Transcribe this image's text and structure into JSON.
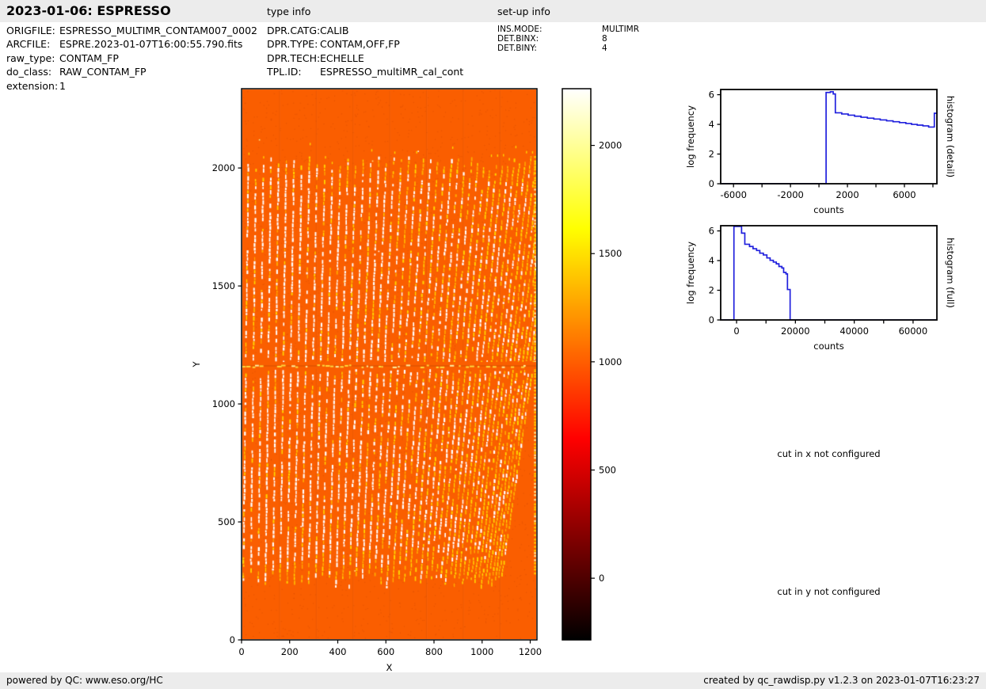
{
  "header": {
    "title": "2023-01-06: ESPRESSO",
    "type_info_label": "type info",
    "setup_info_label": "set-up info"
  },
  "file_info": {
    "rows": [
      {
        "label": "ORIGFILE:",
        "value": "ESPRESSO_MULTIMR_CONTAM007_0002"
      },
      {
        "label": "ARCFILE:",
        "value": "ESPRE.2023-01-07T16:00:55.790.fits"
      },
      {
        "label": "raw_type:",
        "value": "CONTAM_FP"
      },
      {
        "label": "do_class:",
        "value": "RAW_CONTAM_FP"
      },
      {
        "label": "extension:",
        "value": "1"
      }
    ]
  },
  "type_info": {
    "rows": [
      {
        "label": "DPR.CATG:",
        "value": "CALIB"
      },
      {
        "label": "DPR.TYPE:",
        "value": "CONTAM,OFF,FP"
      },
      {
        "label": "DPR.TECH:",
        "value": "ECHELLE"
      },
      {
        "label": "TPL.ID:",
        "value": "ESPRESSO_multiMR_cal_cont"
      }
    ]
  },
  "setup_info": {
    "rows": [
      {
        "label": "INS.MODE:",
        "value": "MULTIMR"
      },
      {
        "label": "DET.BINX:",
        "value": "8"
      },
      {
        "label": "DET.BINY:",
        "value": "4"
      }
    ]
  },
  "messages": {
    "cut_x": "cut in x not configured",
    "cut_y": "cut in y not configured"
  },
  "footer": {
    "left": "powered by QC: www.eso.org/HC",
    "right": "created by qc_rawdisp.py v1.2.3 on 2023-01-07T16:23:27"
  },
  "chart_data": [
    {
      "id": "raw_image",
      "type": "heatmap",
      "title": "",
      "xlabel": "X",
      "ylabel": "Y",
      "xlim": [
        0,
        1228
      ],
      "ylim": [
        0,
        2336
      ],
      "xticks": [
        0,
        200,
        400,
        600,
        800,
        1000,
        1200
      ],
      "yticks": [
        0,
        500,
        1000,
        1500,
        2000
      ],
      "colormap": "hot",
      "background_level_counts": 1000,
      "background_color_hex": "#fa5e00",
      "stripe_color_hexes": [
        "#ffffff",
        "#ffd400",
        "#ffaa00"
      ],
      "stripe_region_y": [
        250,
        2050
      ],
      "stripe_count": 46,
      "bright_row_y": 1165,
      "description": "Raw CONTAM_FP echelle frame: orange background with ~46 near-vertical bright dashed order stripes (whiter at left, denser/yellower and leaning left toward the right edge), a horizontal feature row near Y=1165, faint amplifier seams, plain orange above Y~2050 and below Y~250"
    },
    {
      "id": "colorbar",
      "type": "colorbar",
      "colormap": "hot",
      "ticks": [
        0,
        500,
        1000,
        1500,
        2000
      ],
      "range": [
        -285,
        2262
      ]
    },
    {
      "id": "hist_detail",
      "type": "line",
      "right_label": "histogram (detail)",
      "xlabel": "counts",
      "ylabel": "log frequency",
      "xlim": [
        -6900,
        8280
      ],
      "ylim": [
        0,
        6.35
      ],
      "xticks_all": [
        -6000,
        -4000,
        -2000,
        0,
        2000,
        4000,
        6000,
        8000
      ],
      "xticks_labeled": [
        -6000,
        -2000,
        2000,
        6000
      ],
      "yticks": [
        0,
        2,
        4,
        6
      ],
      "line_color": "#2020dd",
      "grid": false,
      "steps": [
        [
          -6900,
          0
        ],
        [
          500,
          0
        ],
        [
          500,
          6.15
        ],
        [
          800,
          6.2
        ],
        [
          1000,
          6.05
        ],
        [
          1150,
          4.78
        ],
        [
          1600,
          4.7
        ],
        [
          2050,
          4.62
        ],
        [
          2500,
          4.55
        ],
        [
          2950,
          4.48
        ],
        [
          3400,
          4.42
        ],
        [
          3850,
          4.36
        ],
        [
          4300,
          4.3
        ],
        [
          4750,
          4.24
        ],
        [
          5200,
          4.18
        ],
        [
          5650,
          4.12
        ],
        [
          6100,
          4.06
        ],
        [
          6500,
          4.0
        ],
        [
          6900,
          3.95
        ],
        [
          7300,
          3.9
        ],
        [
          7700,
          3.82
        ],
        [
          8100,
          3.78
        ],
        [
          8100,
          4.75
        ],
        [
          8280,
          4.75
        ]
      ]
    },
    {
      "id": "hist_full",
      "type": "line",
      "right_label": "histogram (full)",
      "xlabel": "counts",
      "ylabel": "log frequency",
      "xlim": [
        -5400,
        68100
      ],
      "ylim": [
        0,
        6.35
      ],
      "xticks_all": [
        0,
        10000,
        20000,
        30000,
        40000,
        50000,
        60000
      ],
      "xticks_labeled": [
        0,
        20000,
        40000,
        60000
      ],
      "yticks": [
        0,
        2,
        4,
        6
      ],
      "line_color": "#2020dd",
      "grid": false,
      "steps": [
        [
          -5400,
          0
        ],
        [
          -900,
          0
        ],
        [
          -900,
          6.3
        ],
        [
          1700,
          5.85
        ],
        [
          2800,
          5.1
        ],
        [
          4400,
          4.95
        ],
        [
          5600,
          4.8
        ],
        [
          6800,
          4.68
        ],
        [
          7900,
          4.5
        ],
        [
          9100,
          4.38
        ],
        [
          10300,
          4.18
        ],
        [
          11400,
          4.02
        ],
        [
          12500,
          3.9
        ],
        [
          13500,
          3.78
        ],
        [
          14400,
          3.6
        ],
        [
          15400,
          3.5
        ],
        [
          16000,
          3.2
        ],
        [
          16800,
          3.1
        ],
        [
          17300,
          2.05
        ],
        [
          18200,
          0
        ],
        [
          68100,
          0
        ]
      ]
    }
  ]
}
